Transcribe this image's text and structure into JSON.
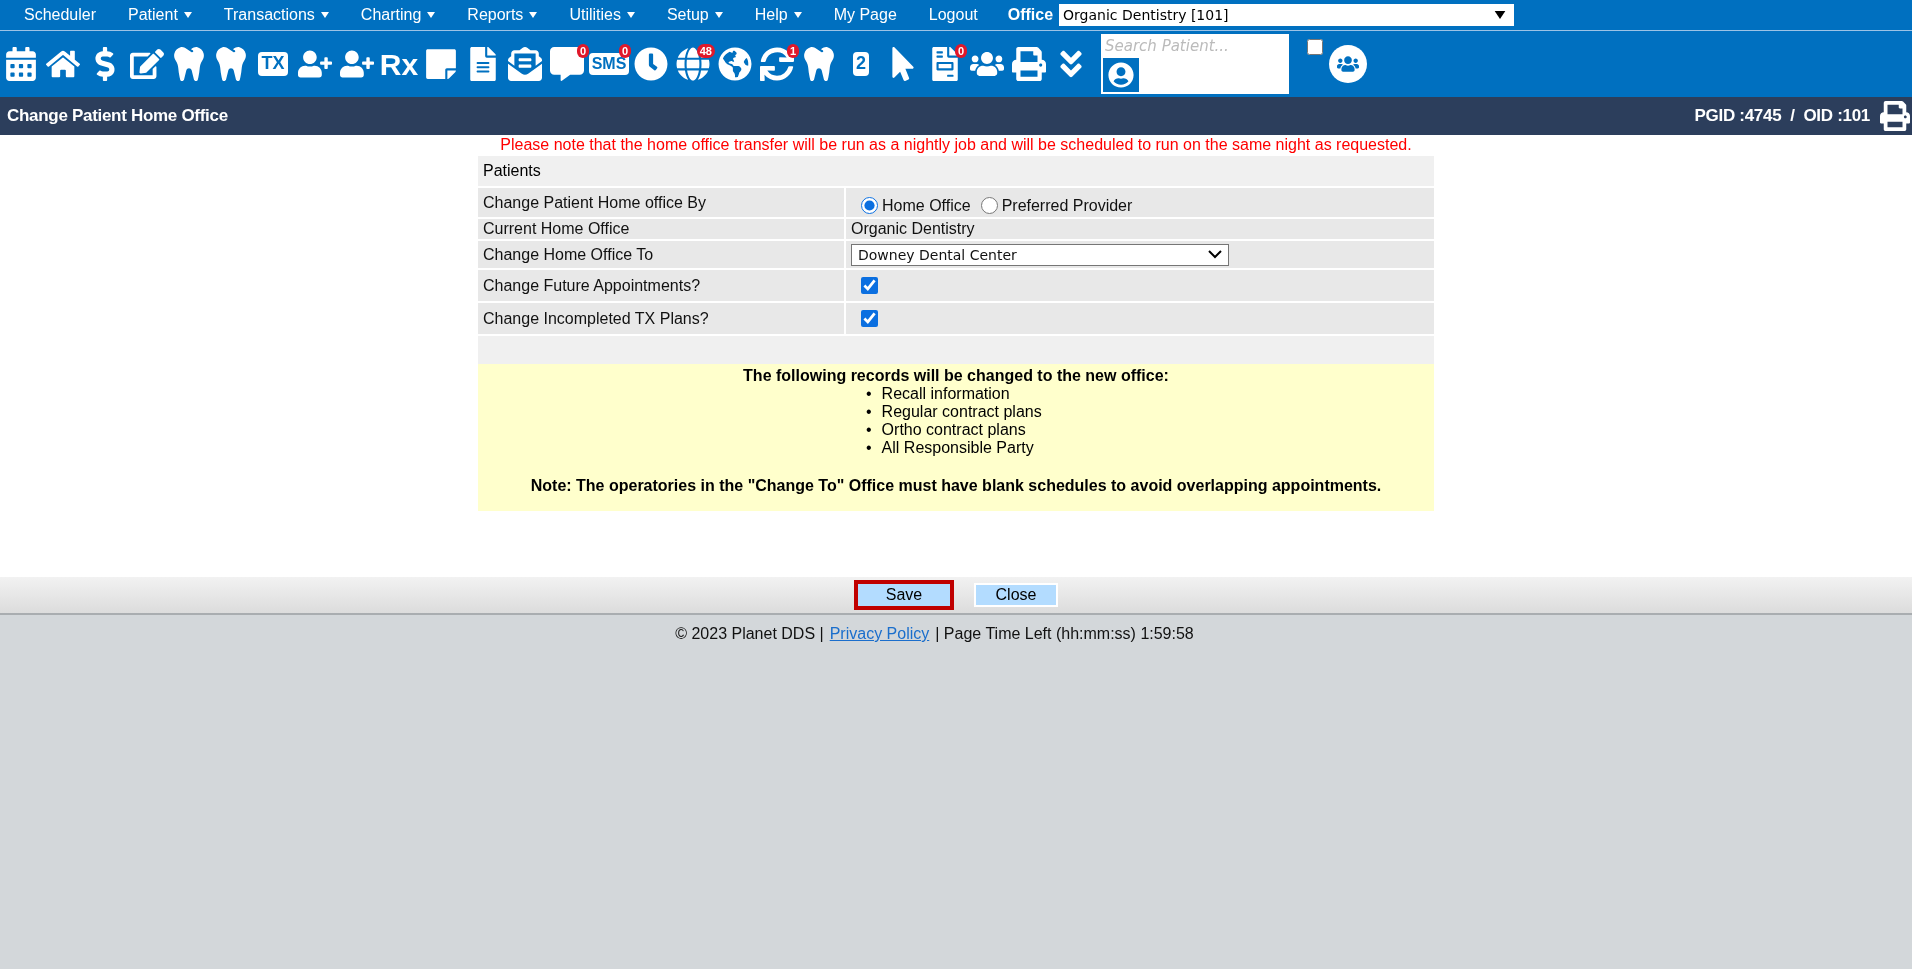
{
  "menu": {
    "items": [
      {
        "label": "Scheduler",
        "has_menu": false
      },
      {
        "label": "Patient",
        "has_menu": true
      },
      {
        "label": "Transactions",
        "has_menu": true
      },
      {
        "label": "Charting",
        "has_menu": true
      },
      {
        "label": "Reports",
        "has_menu": true
      },
      {
        "label": "Utilities",
        "has_menu": true
      },
      {
        "label": "Setup",
        "has_menu": true
      },
      {
        "label": "Help",
        "has_menu": true
      },
      {
        "label": "My Page",
        "has_menu": false
      },
      {
        "label": "Logout",
        "has_menu": false
      }
    ],
    "office_label": "Office",
    "office_value": "Organic Dentistry [101]"
  },
  "toolbar": {
    "items": [
      {
        "kind": "calendar"
      },
      {
        "kind": "home"
      },
      {
        "kind": "dollar"
      },
      {
        "kind": "edit"
      },
      {
        "kind": "tooth-card"
      },
      {
        "kind": "tooth"
      },
      {
        "kind": "text-calendar",
        "text": "TX"
      },
      {
        "kind": "user-plus"
      },
      {
        "kind": "user-plus"
      },
      {
        "kind": "text",
        "text": "Rx"
      },
      {
        "kind": "note"
      },
      {
        "kind": "scanner"
      },
      {
        "kind": "mail"
      },
      {
        "kind": "chat",
        "badge": "0"
      },
      {
        "kind": "text-bubble",
        "text": "SMS",
        "badge": "0"
      },
      {
        "kind": "clock"
      },
      {
        "kind": "globe-user",
        "badge": "48"
      },
      {
        "kind": "globe-person"
      },
      {
        "kind": "sync-user",
        "badge": "1"
      },
      {
        "kind": "tooth-card"
      },
      {
        "kind": "tooth-number",
        "text": "2"
      },
      {
        "kind": "globe-cursor"
      },
      {
        "kind": "doc-check",
        "badge": "0"
      },
      {
        "kind": "group"
      },
      {
        "kind": "printer"
      },
      {
        "kind": "chevrons"
      }
    ],
    "search_placeholder": "Search Patient...",
    "checkbox_checked": false
  },
  "header": {
    "title": "Change Patient Home Office",
    "ids": "PGID :4745  /  OID :101"
  },
  "notice": "Please note that the home office transfer will be run as a nightly job and will be scheduled to run on the same night as requested.",
  "form": {
    "rows": [
      {
        "kind": "section",
        "label": "Patients"
      },
      {
        "kind": "radio",
        "label": "Change Patient Home office By",
        "options": [
          {
            "label": "Home Office",
            "selected": true
          },
          {
            "label": "Preferred Provider",
            "selected": false
          }
        ]
      },
      {
        "kind": "text",
        "label": "Current Home Office",
        "value": "Organic Dentistry"
      },
      {
        "kind": "select",
        "label": "Change Home Office To",
        "value": "Downey Dental Center"
      },
      {
        "kind": "checkbox",
        "label": "Change Future Appointments?",
        "checked": true
      },
      {
        "kind": "checkbox",
        "label": "Change Incompleted TX Plans?",
        "checked": true
      },
      {
        "kind": "blank"
      }
    ]
  },
  "info": {
    "heading": "The following records will be changed to the new office:",
    "items": [
      {
        "marker": "•",
        "text": "Recall information"
      },
      {
        "marker": "•",
        "text": "Regular contract plans"
      },
      {
        "marker": "•",
        "text": "Ortho contract plans"
      },
      {
        "marker": "•",
        "text": "All Responsible Party"
      }
    ],
    "note": "Note: The operatories in the \"Change To\" Office must have blank schedules to avoid overlapping appointments."
  },
  "buttons": [
    {
      "label": "Save",
      "highlighted": true
    },
    {
      "label": "Close",
      "highlighted": false
    }
  ],
  "footer": {
    "copyright": "© 2023 Planet DDS |",
    "link": "Privacy Policy",
    "time": "| Page Time Left (hh:mm:ss) 1:59:58"
  }
}
